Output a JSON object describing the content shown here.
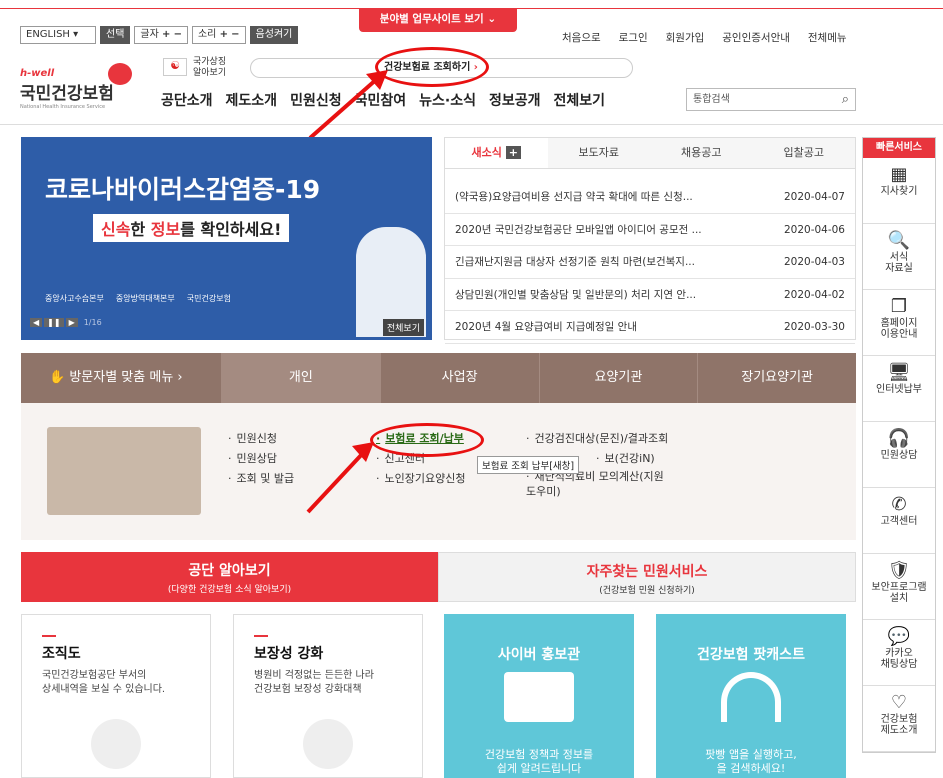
{
  "top_banner": {
    "label": "분야별 업무사이트 보기"
  },
  "util": {
    "lang": "ENGLISH",
    "select": "선택",
    "font": "글자",
    "sound": "소리",
    "voice": "음성켜기"
  },
  "topnav": [
    "처음으로",
    "로그인",
    "회원가입",
    "공인인증서안내",
    "전체메뉴"
  ],
  "logo": {
    "sub": "h-well",
    "name": "국민건강보험",
    "eng": "National Health Insurance Service",
    "flag_text": "국가상징\n알아보기"
  },
  "search_pill": {
    "label": "건강보험료 조회하기"
  },
  "gnb": [
    "공단소개",
    "제도소개",
    "민원신청",
    "국민참여",
    "뉴스·소식",
    "정보공개",
    "전체보기"
  ],
  "search": {
    "placeholder": "통합검색"
  },
  "hero": {
    "title": "코로나바이러스감염증-19",
    "sub_a": "신속",
    "sub_b": "한 ",
    "sub_c": "정보",
    "sub_d": "를 확인하세요!",
    "org1": "중앙사고수습본부",
    "org2": "중앙방역대책본부",
    "org3": "국민건강보험",
    "page": "1/16",
    "view_all": "전체보기"
  },
  "news": {
    "tabs": [
      "새소식",
      "보도자료",
      "채용공고",
      "입찰공고"
    ],
    "items": [
      {
        "title": "(약국용)요양급여비용 선지급 약국 확대에 따른 신청...",
        "date": "2020-04-07"
      },
      {
        "title": "2020년 국민건강보험공단 모바일앱 아이디어 공모전 ...",
        "date": "2020-04-06"
      },
      {
        "title": "긴급재난지원금 대상자 선정기준 원칙 마련(보건복지...",
        "date": "2020-04-03"
      },
      {
        "title": "상담민원(개인별 맞춤상담 및 일반문의) 처리 지연 안...",
        "date": "2020-04-02"
      },
      {
        "title": "2020년 4월 요양급여비 지급예정일 안내",
        "date": "2020-03-30"
      }
    ]
  },
  "quick": {
    "title": "빠른서비스",
    "items": [
      {
        "icon": "building-icon",
        "g": "▦",
        "label": "지사찾기"
      },
      {
        "icon": "doc-search-icon",
        "g": "🔍",
        "label": "서식\n자료실"
      },
      {
        "icon": "pages-icon",
        "g": "❐",
        "label": "홈페이지\n이용안내"
      },
      {
        "icon": "monitor-icon",
        "g": "🖥",
        "label": "인터넷납부"
      },
      {
        "icon": "headset-icon",
        "g": "🎧",
        "label": "민원상담"
      },
      {
        "icon": "phone-icon",
        "g": "✆",
        "label": "고객센터"
      },
      {
        "icon": "shield-icon",
        "g": "🛡",
        "label": "보안프로그램\n설치"
      },
      {
        "icon": "talk-icon",
        "g": "💬",
        "label": "카카오\n채팅상담"
      },
      {
        "icon": "heart-icon",
        "g": "♡",
        "label": "건강보험\n제도소개"
      }
    ]
  },
  "visitor": {
    "title": "방문자별 맞춤 메뉴",
    "tabs": [
      "개인",
      "사업장",
      "요양기관",
      "장기요양기관"
    ],
    "col1": [
      "민원신청",
      "민원상담",
      "조회 및 발급"
    ],
    "col2": [
      "보험료 조회/납부",
      "신고센터",
      "노인장기요양신청"
    ],
    "col3": [
      "건강검진대상(문진)/결과조회",
      "보(건강iN)",
      "재난적의료비 모의계산(지원\n도우미)"
    ],
    "tooltip": "보험료 조회 납부[새창]"
  },
  "promo": {
    "left": {
      "title": "공단 알아보기",
      "sub": "(다양한 건강보험 소식 알아보기)"
    },
    "right": {
      "title": "자주찾는 민원서비스",
      "sub": "(건강보험 민원 신청하기)"
    }
  },
  "cards": [
    {
      "title": "조직도",
      "desc": "국민건강보험공단 부서의\n상세내역을 보실 수 있습니다."
    },
    {
      "title": "보장성 강화",
      "desc": "병원비 걱정없는 든든한 나라\n건강보험 보장성 강화대책"
    },
    {
      "title": "사이버 홍보관",
      "desc": "건강보험 정책과 정보를\n쉽게 알려드립니다"
    },
    {
      "title": "건강보험 팟캐스트",
      "desc": "팟빵 앱을 실행하고,\n을 검색하세요!"
    }
  ],
  "colors": {
    "brand_red": "#e8353d",
    "menu_brown": "#8f7469",
    "hero_blue": "#2e5da8"
  }
}
